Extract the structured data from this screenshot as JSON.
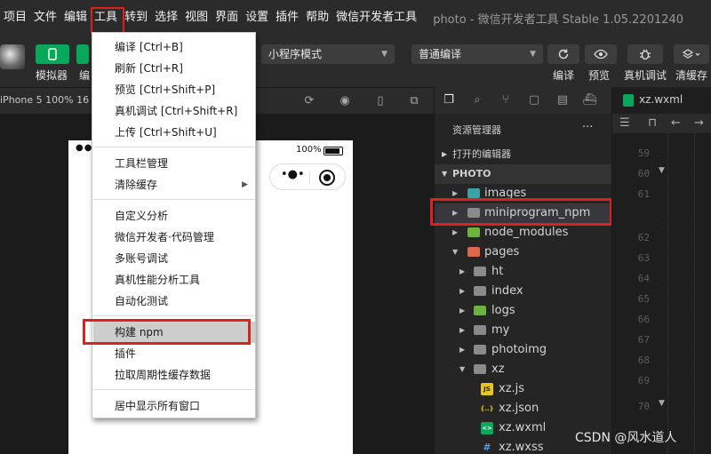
{
  "menubar": {
    "items": [
      "项目",
      "文件",
      "编辑",
      "工具",
      "转到",
      "选择",
      "视图",
      "界面",
      "设置",
      "插件",
      "帮助",
      "微信开发者工具"
    ],
    "active_item": "工具",
    "window_title": "photo - 微信开发者工具 Stable 1.05.2201240"
  },
  "toolbar": {
    "simulator_label": "模拟器",
    "editor_label": "编",
    "mode_select": "小程序模式",
    "compile_select": "普通编译",
    "compile_label": "编译",
    "preview_label": "预览",
    "remote_debug_label": "真机调试",
    "clear_cache_label": "清缓存"
  },
  "simulator": {
    "device_label": "iPhone 5 100% 16",
    "battery_text": "100%",
    "signal_text": "●●●●●"
  },
  "tools_menu": {
    "items": [
      {
        "label": "编译  [Ctrl+B]"
      },
      {
        "label": "刷新  [Ctrl+R]"
      },
      {
        "label": "预览  [Ctrl+Shift+P]"
      },
      {
        "label": "真机调试  [Ctrl+Shift+R]"
      },
      {
        "label": "上传  [Ctrl+Shift+U]"
      },
      {
        "label": "工具栏管理"
      },
      {
        "label": "清除缓存",
        "submenu": true
      },
      {
        "label": "自定义分析"
      },
      {
        "label": "微信开发者·代码管理"
      },
      {
        "label": "多账号调试"
      },
      {
        "label": "真机性能分析工具"
      },
      {
        "label": "自动化测试"
      },
      {
        "label": "构建 npm",
        "selected": true
      },
      {
        "label": "插件"
      },
      {
        "label": "拉取周期性缓存数据"
      },
      {
        "label": "居中显示所有窗口"
      }
    ]
  },
  "explorer": {
    "title": "资源管理器",
    "more": "···",
    "open_editors": "打开的编辑器",
    "project": "PHOTO",
    "tree": [
      {
        "label": "images"
      },
      {
        "label": "miniprogram_npm"
      },
      {
        "label": "node_modules"
      },
      {
        "label": "pages"
      },
      {
        "label": "ht"
      },
      {
        "label": "index"
      },
      {
        "label": "logs"
      },
      {
        "label": "my"
      },
      {
        "label": "photoimg"
      },
      {
        "label": "xz"
      },
      {
        "label": "xz.js",
        "badge": "JS"
      },
      {
        "label": "xz.json",
        "badge": "{..}"
      },
      {
        "label": "xz.wxml",
        "badge": "<>"
      },
      {
        "label": "xz.wxss",
        "badge": "#"
      }
    ]
  },
  "editor": {
    "tab_title": "xz.wxml",
    "line_numbers": [
      "59",
      "60",
      "61",
      "62",
      "63",
      "64",
      "65",
      "66",
      "67",
      "68",
      "69",
      "70"
    ]
  },
  "watermark": "CSDN @风水道人",
  "colors": {
    "highlight": "#e02020",
    "green": "#07a85a",
    "menubar_bg": "#2b2b2b",
    "menu_selected_bg": "#cdcdcd"
  }
}
